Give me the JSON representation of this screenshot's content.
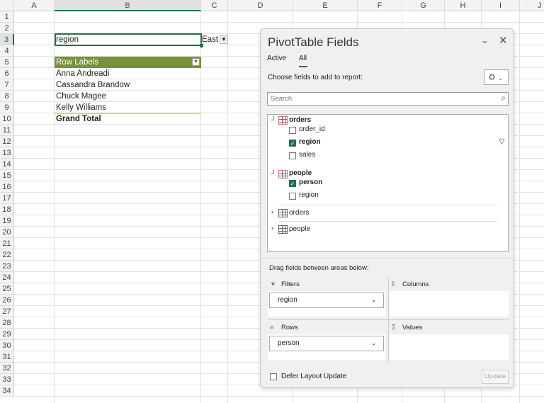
{
  "sheet": {
    "columns": [
      "A",
      "B",
      "C",
      "D",
      "E",
      "F",
      "G",
      "H",
      "I",
      "J"
    ],
    "rows": [
      "1",
      "2",
      "3",
      "4",
      "5",
      "6",
      "7",
      "8",
      "9",
      "10",
      "11",
      "12",
      "13",
      "14",
      "15",
      "16",
      "17",
      "18",
      "19",
      "20",
      "21",
      "22",
      "23",
      "24",
      "25",
      "26",
      "27",
      "28",
      "29",
      "30",
      "31",
      "32",
      "33",
      "34"
    ],
    "selected_column": "B",
    "selected_row": "3",
    "filter_label": "region",
    "filter_value": "East",
    "row_labels_header": "Row Labels",
    "row_items": [
      "Anna Andreadi",
      "Cassandra Brandow",
      "Chuck Magee",
      "Kelly Williams"
    ],
    "grand_total": "Grand Total",
    "accent_color": "#76923c"
  },
  "pane": {
    "title": "PivotTable Fields",
    "tabs": [
      {
        "label": "Active",
        "active": false
      },
      {
        "label": "All",
        "active": true
      }
    ],
    "choose_label": "Choose fields to add to report:",
    "search_placeholder": "Search",
    "tables": [
      {
        "name": "orders",
        "fields": [
          {
            "name": "order_id",
            "checked": false
          },
          {
            "name": "region",
            "checked": true,
            "filtered": true
          },
          {
            "name": "sales",
            "checked": false
          }
        ]
      },
      {
        "name": "people",
        "fields": [
          {
            "name": "person",
            "checked": true
          },
          {
            "name": "region",
            "checked": false
          }
        ]
      }
    ],
    "collapsed_tables": [
      "orders",
      "people"
    ],
    "drag_label": "Drag fields between areas below:",
    "areas": {
      "filters": {
        "label": "Filters",
        "items": [
          "region"
        ]
      },
      "columns": {
        "label": "Columns",
        "items": []
      },
      "rows": {
        "label": "Rows",
        "items": [
          "person"
        ]
      },
      "values": {
        "label": "Values",
        "items": []
      }
    },
    "defer_label": "Defer Layout Update",
    "update_label": "Update"
  }
}
